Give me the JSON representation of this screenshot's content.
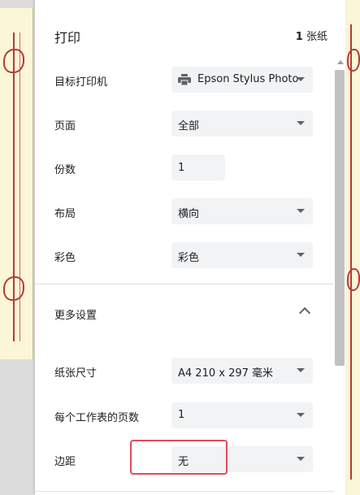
{
  "dialog": {
    "title": "打印",
    "sheet_count_number": "1",
    "sheet_count_unit": "张纸"
  },
  "settings": {
    "destination": {
      "label": "目标打印机",
      "value": "Epson Stylus Photo",
      "icon": "printer-icon"
    },
    "pages": {
      "label": "页面",
      "value": "全部"
    },
    "copies": {
      "label": "份数",
      "value": "1"
    },
    "layout": {
      "label": "布局",
      "value": "横向"
    },
    "color": {
      "label": "彩色",
      "value": "彩色"
    }
  },
  "more_settings": {
    "label": "更多设置",
    "expanded": true,
    "paper_size": {
      "label": "纸张尺寸",
      "value": "A4 210 x 297 毫米"
    },
    "pages_per_sheet": {
      "label": "每个工作表的页数",
      "value": "1"
    },
    "margins": {
      "label": "边距",
      "value": "无"
    }
  },
  "colors": {
    "highlight": "#e24b5b",
    "field_background": "#f1f3f4",
    "preview_paper": "#fbf6d6",
    "ornament": "#b53b3b"
  }
}
